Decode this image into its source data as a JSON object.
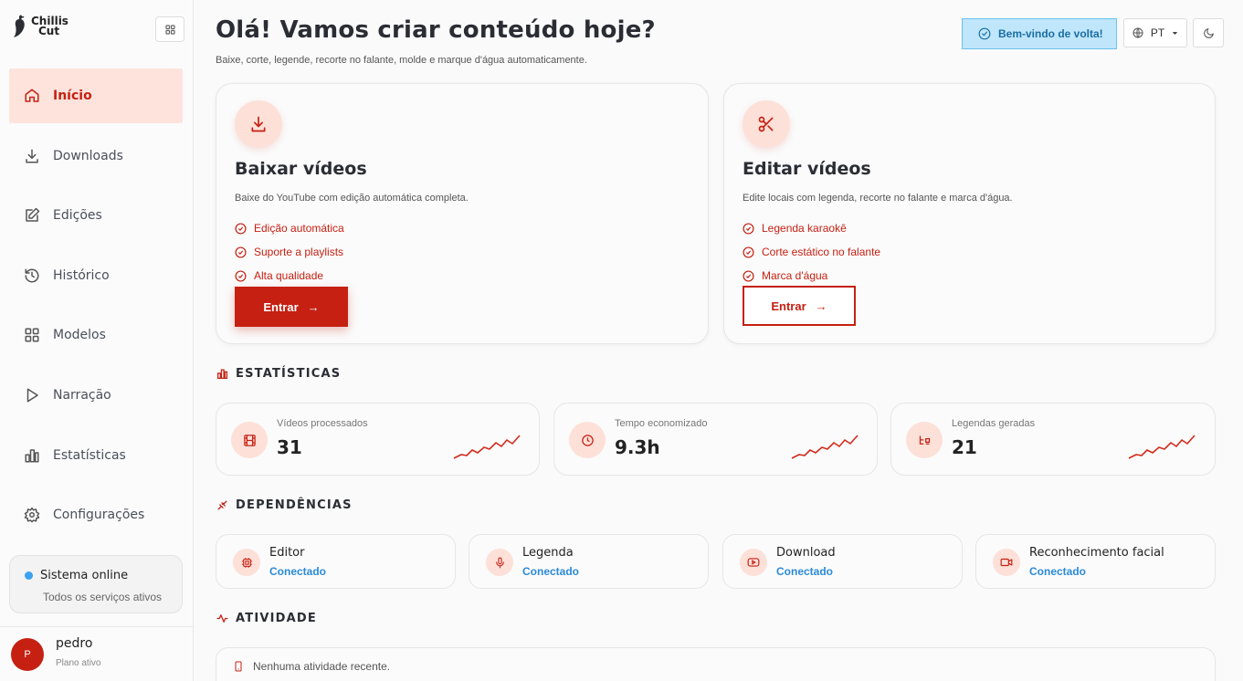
{
  "brand": {
    "line1": "Chillis",
    "line2": "Cut"
  },
  "sidebar": {
    "items": [
      {
        "label": "Início",
        "icon": "home-icon",
        "active": true
      },
      {
        "label": "Downloads",
        "icon": "download-icon"
      },
      {
        "label": "Edições",
        "icon": "edit-icon"
      },
      {
        "label": "Histórico",
        "icon": "history-icon"
      },
      {
        "label": "Modelos",
        "icon": "grid-icon"
      },
      {
        "label": "Narração",
        "icon": "play-icon"
      },
      {
        "label": "Estatísticas",
        "icon": "bar-chart-icon"
      },
      {
        "label": "Configurações",
        "icon": "gear-icon"
      }
    ],
    "status": {
      "title": "Sistema online",
      "subtitle": "Todos os serviços ativos"
    },
    "user": {
      "initial": "P",
      "name": "pedro",
      "plan": "Plano ativo"
    }
  },
  "header": {
    "title": "Olá! Vamos criar conteúdo hoje?",
    "subtitle": "Baixe, corte, legende, recorte no falante, molde e marque d'água automaticamente.",
    "welcome": "Bem-vindo de volta!",
    "language": "PT"
  },
  "cards": [
    {
      "title": "Baixar vídeos",
      "description": "Baixe do YouTube com edição automática completa.",
      "features": [
        "Edição automática",
        "Suporte a playlists",
        "Alta qualidade"
      ],
      "button": "Entrar",
      "icon": "download-icon"
    },
    {
      "title": "Editar vídeos",
      "description": "Edite locais com legenda, recorte no falante e marca d'água.",
      "features": [
        "Legenda karaokê",
        "Corte estático no falante",
        "Marca d'água"
      ],
      "button": "Entrar",
      "icon": "scissors-icon"
    }
  ],
  "statistics": {
    "heading": "ESTATÍSTICAS",
    "items": [
      {
        "label": "Vídeos processados",
        "value": "31",
        "icon": "film-icon"
      },
      {
        "label": "Tempo economizado",
        "value": "9.3h",
        "icon": "clock-icon"
      },
      {
        "label": "Legendas geradas",
        "value": "21",
        "icon": "subtitles-icon"
      }
    ]
  },
  "dependencies": {
    "heading": "DEPENDÊNCIAS",
    "items": [
      {
        "name": "Editor",
        "status": "Conectado",
        "icon": "cpu-icon"
      },
      {
        "name": "Legenda",
        "status": "Conectado",
        "icon": "mic-icon"
      },
      {
        "name": "Download",
        "status": "Conectado",
        "icon": "youtube-icon"
      },
      {
        "name": "Reconhecimento facial",
        "status": "Conectado",
        "icon": "video-icon"
      }
    ]
  },
  "activity": {
    "heading": "ATIVIDADE",
    "empty": "Nenhuma atividade recente."
  },
  "colors": {
    "accent": "#c52012",
    "accent_soft": "#fde0d8",
    "info": "#2b8ad6",
    "welcome_bg": "#bfe6fb"
  }
}
